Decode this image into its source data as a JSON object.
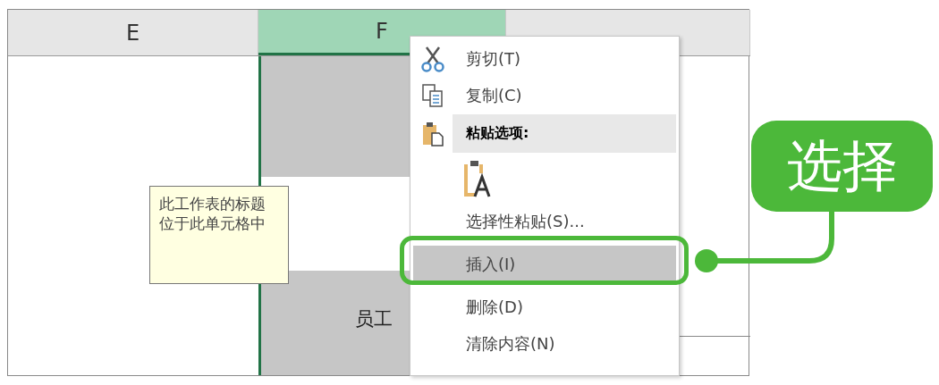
{
  "sheet": {
    "columns": [
      {
        "label": "E",
        "selected": false
      },
      {
        "label": "F",
        "selected": true
      },
      {
        "selected": false
      }
    ],
    "cell_text": "员工"
  },
  "tooltip": {
    "text": "此工作表的标题位于此单元格中"
  },
  "context_menu": {
    "items": [
      {
        "kind": "item",
        "label": "剪切(T)",
        "selected": false
      },
      {
        "kind": "item",
        "label": "复制(C)",
        "selected": false
      },
      {
        "kind": "header",
        "label": "粘贴选项:"
      },
      {
        "kind": "paste_options"
      },
      {
        "kind": "item",
        "label": "选择性粘贴(S)...",
        "selected": false
      },
      {
        "kind": "item",
        "label": "插入(I)",
        "selected": true
      },
      {
        "kind": "item",
        "label": "删除(D)",
        "selected": false
      },
      {
        "kind": "item",
        "label": "清除内容(N)",
        "selected": false
      }
    ]
  },
  "callout": {
    "label": "选择"
  }
}
